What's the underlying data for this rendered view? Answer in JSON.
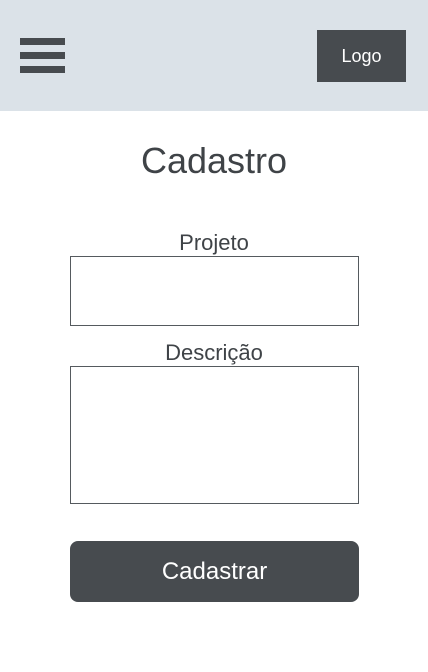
{
  "header": {
    "menu_icon": "hamburger-menu-icon",
    "logo_label": "Logo",
    "background": "#dbe2e8",
    "accent": "#474b4f"
  },
  "page": {
    "title": "Cadastro"
  },
  "form": {
    "project": {
      "label": "Projeto",
      "value": "",
      "placeholder": ""
    },
    "description": {
      "label": "Descrição",
      "value": "",
      "placeholder": ""
    },
    "submit_label": "Cadastrar"
  }
}
